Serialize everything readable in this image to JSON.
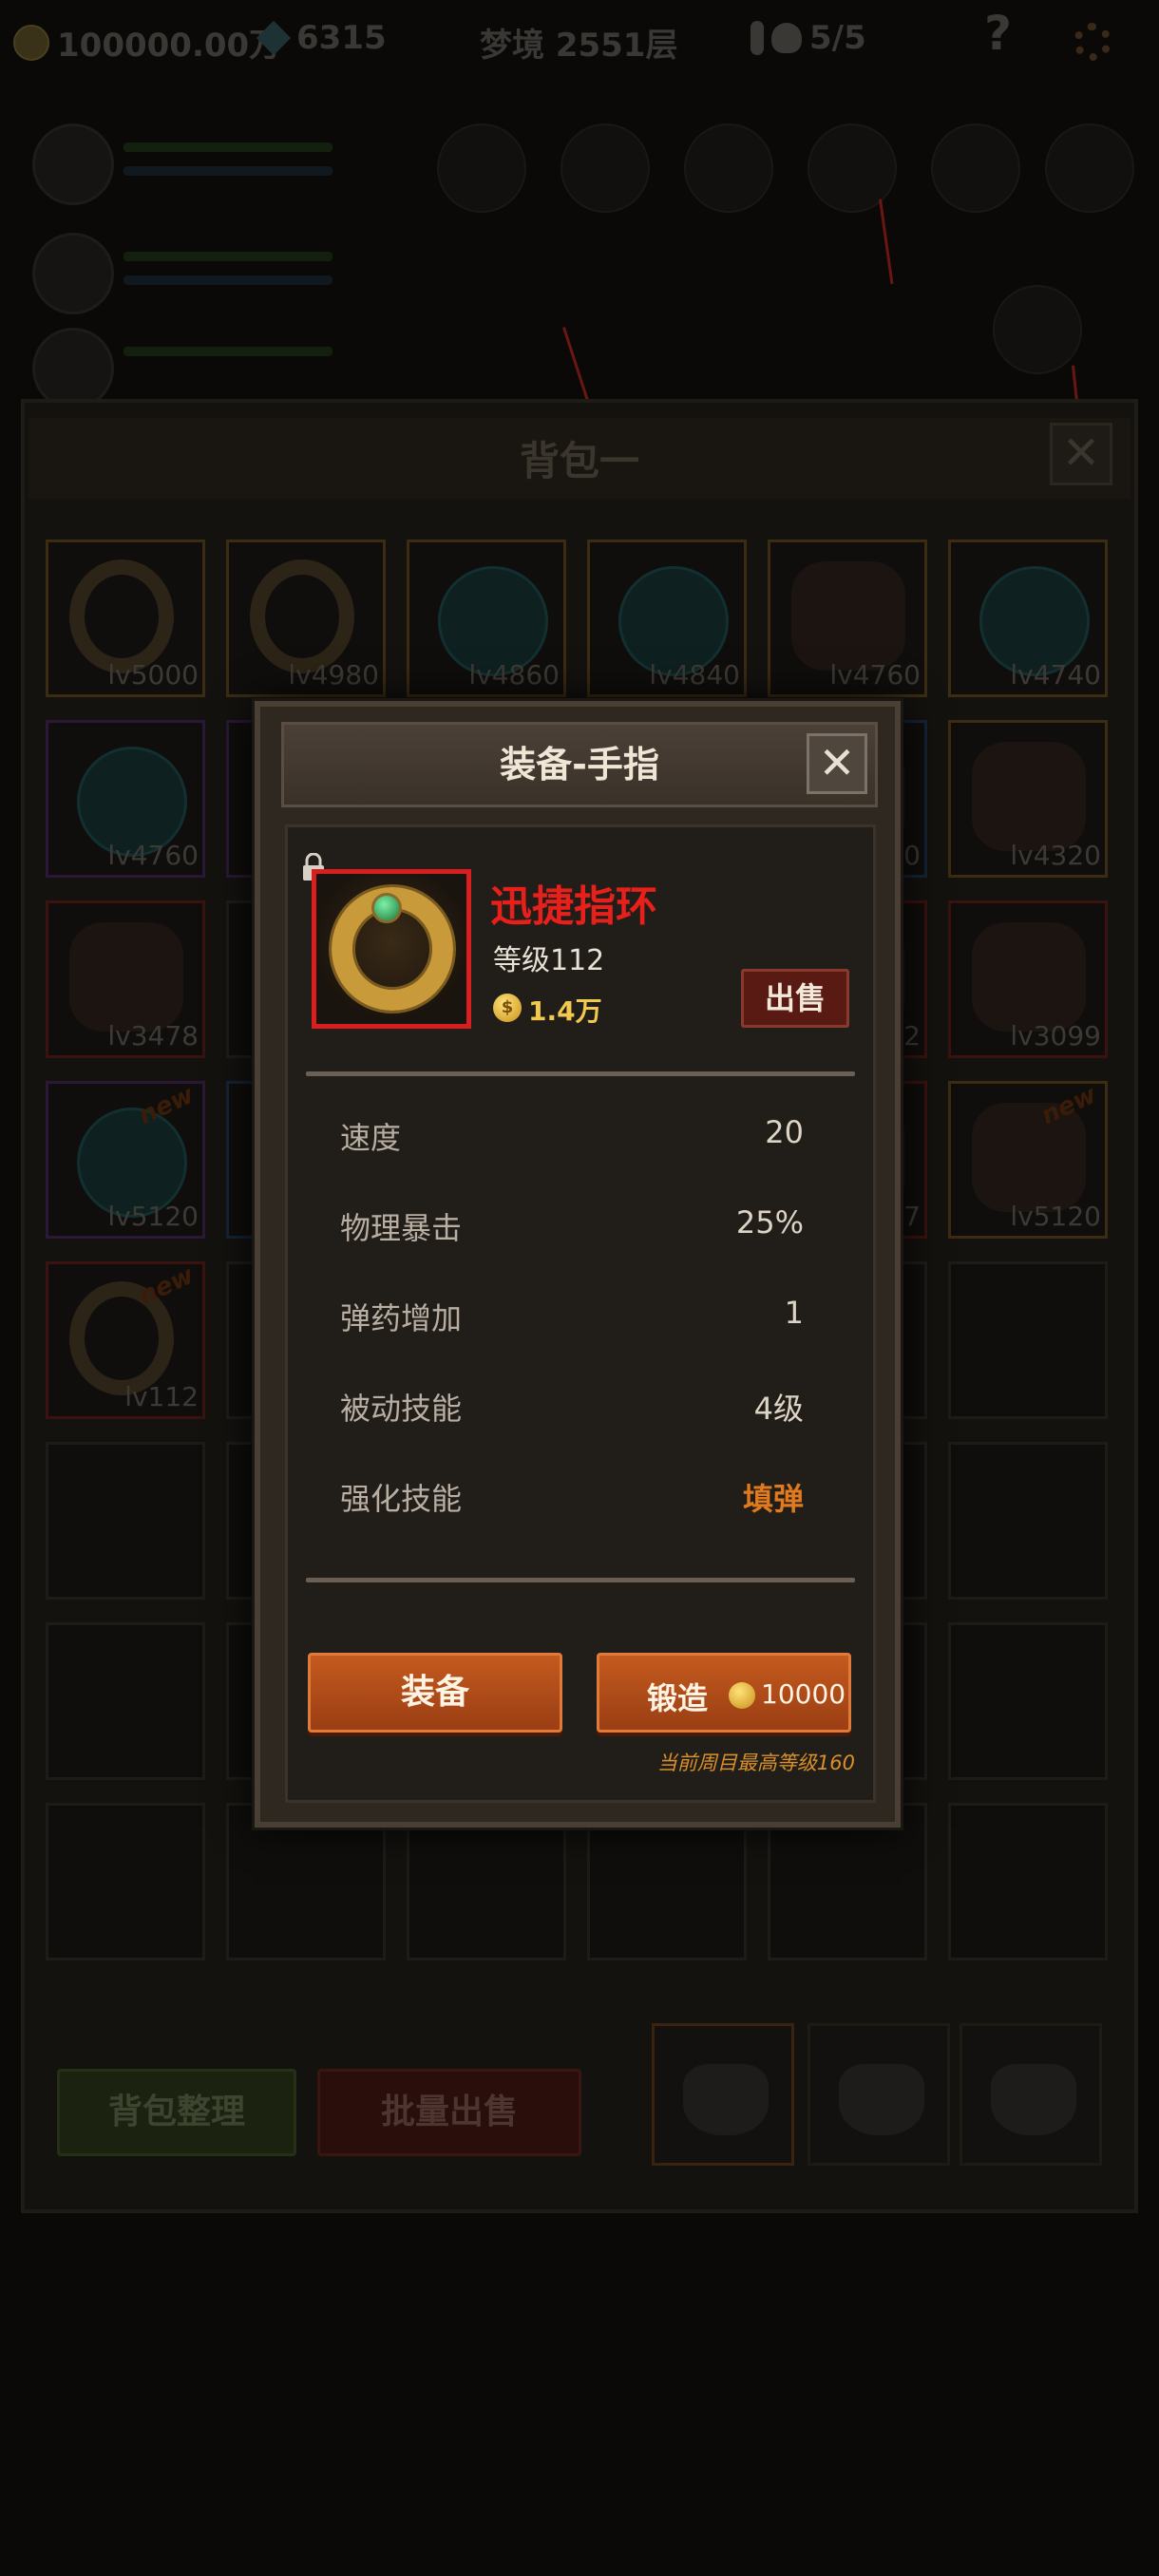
{
  "hud": {
    "gold": "100000.00万",
    "gems": "6315",
    "stage": "梦境 2551层",
    "keys_skulls": "5/5",
    "icons": [
      "coin-icon",
      "gem-icon",
      "key-icon",
      "skull-icon",
      "help-icon",
      "settings-icon"
    ]
  },
  "bag": {
    "title": "背包一",
    "close_label": "✕",
    "sort_label": "背包整理",
    "bulk_sell_label": "批量出售",
    "cells": [
      {
        "lv": "lv5000",
        "kind": "ring",
        "rarity": "gold"
      },
      {
        "lv": "lv4980",
        "kind": "ring",
        "rarity": "gold"
      },
      {
        "lv": "lv4860",
        "kind": "orb",
        "rarity": "gold"
      },
      {
        "lv": "lv4840",
        "kind": "orb",
        "rarity": "gold"
      },
      {
        "lv": "lv4760",
        "kind": "glove",
        "rarity": "gold"
      },
      {
        "lv": "lv4740",
        "kind": "orb",
        "rarity": "gold"
      },
      {
        "lv": "lv4760",
        "kind": "orb",
        "rarity": "purple"
      },
      {
        "lv": "",
        "kind": "empty",
        "rarity": "purple"
      },
      {
        "lv": "",
        "kind": "empty",
        "rarity": ""
      },
      {
        "lv": "",
        "kind": "empty",
        "rarity": ""
      },
      {
        "lv": "00",
        "kind": "gen",
        "rarity": "blue"
      },
      {
        "lv": "lv4320",
        "kind": "amulet",
        "rarity": "gold"
      },
      {
        "lv": "lv3478",
        "kind": "helmet",
        "rarity": "red"
      },
      {
        "lv": "",
        "kind": "empty",
        "rarity": ""
      },
      {
        "lv": "",
        "kind": "empty",
        "rarity": ""
      },
      {
        "lv": "",
        "kind": "empty",
        "rarity": ""
      },
      {
        "lv": "82",
        "kind": "gen",
        "rarity": "red"
      },
      {
        "lv": "lv3099",
        "kind": "armor",
        "rarity": "red"
      },
      {
        "lv": "lv5120",
        "kind": "orb",
        "rarity": "purple",
        "new": "new"
      },
      {
        "lv": "",
        "kind": "empty",
        "rarity": "blue"
      },
      {
        "lv": "",
        "kind": "empty",
        "rarity": ""
      },
      {
        "lv": "",
        "kind": "empty",
        "rarity": ""
      },
      {
        "lv": "07",
        "kind": "gen",
        "rarity": "red"
      },
      {
        "lv": "lv5120",
        "kind": "claw",
        "rarity": "gold",
        "new": "new"
      },
      {
        "lv": "lv112",
        "kind": "ring",
        "rarity": "red",
        "new": "new"
      }
    ]
  },
  "modal": {
    "title": "装备-手指",
    "close_label": "✕",
    "item": {
      "name": "迅捷指环",
      "level_label": "等级112",
      "price": "1.4万",
      "coin_glyph": "$",
      "name_color": "#e8201c"
    },
    "sell_label": "出售",
    "stats": [
      {
        "label": "速度",
        "value": "20"
      },
      {
        "label": "物理暴击",
        "value": "25%"
      },
      {
        "label": "弹药增加",
        "value": "1"
      },
      {
        "label": "被动技能",
        "value": "4级"
      },
      {
        "label": "强化技能",
        "value": "填弹",
        "accent": true
      }
    ],
    "equip_label": "装备",
    "forge_label": "锻造",
    "forge_cost": "10000",
    "max_level_note": "当前周目最高等级160"
  }
}
